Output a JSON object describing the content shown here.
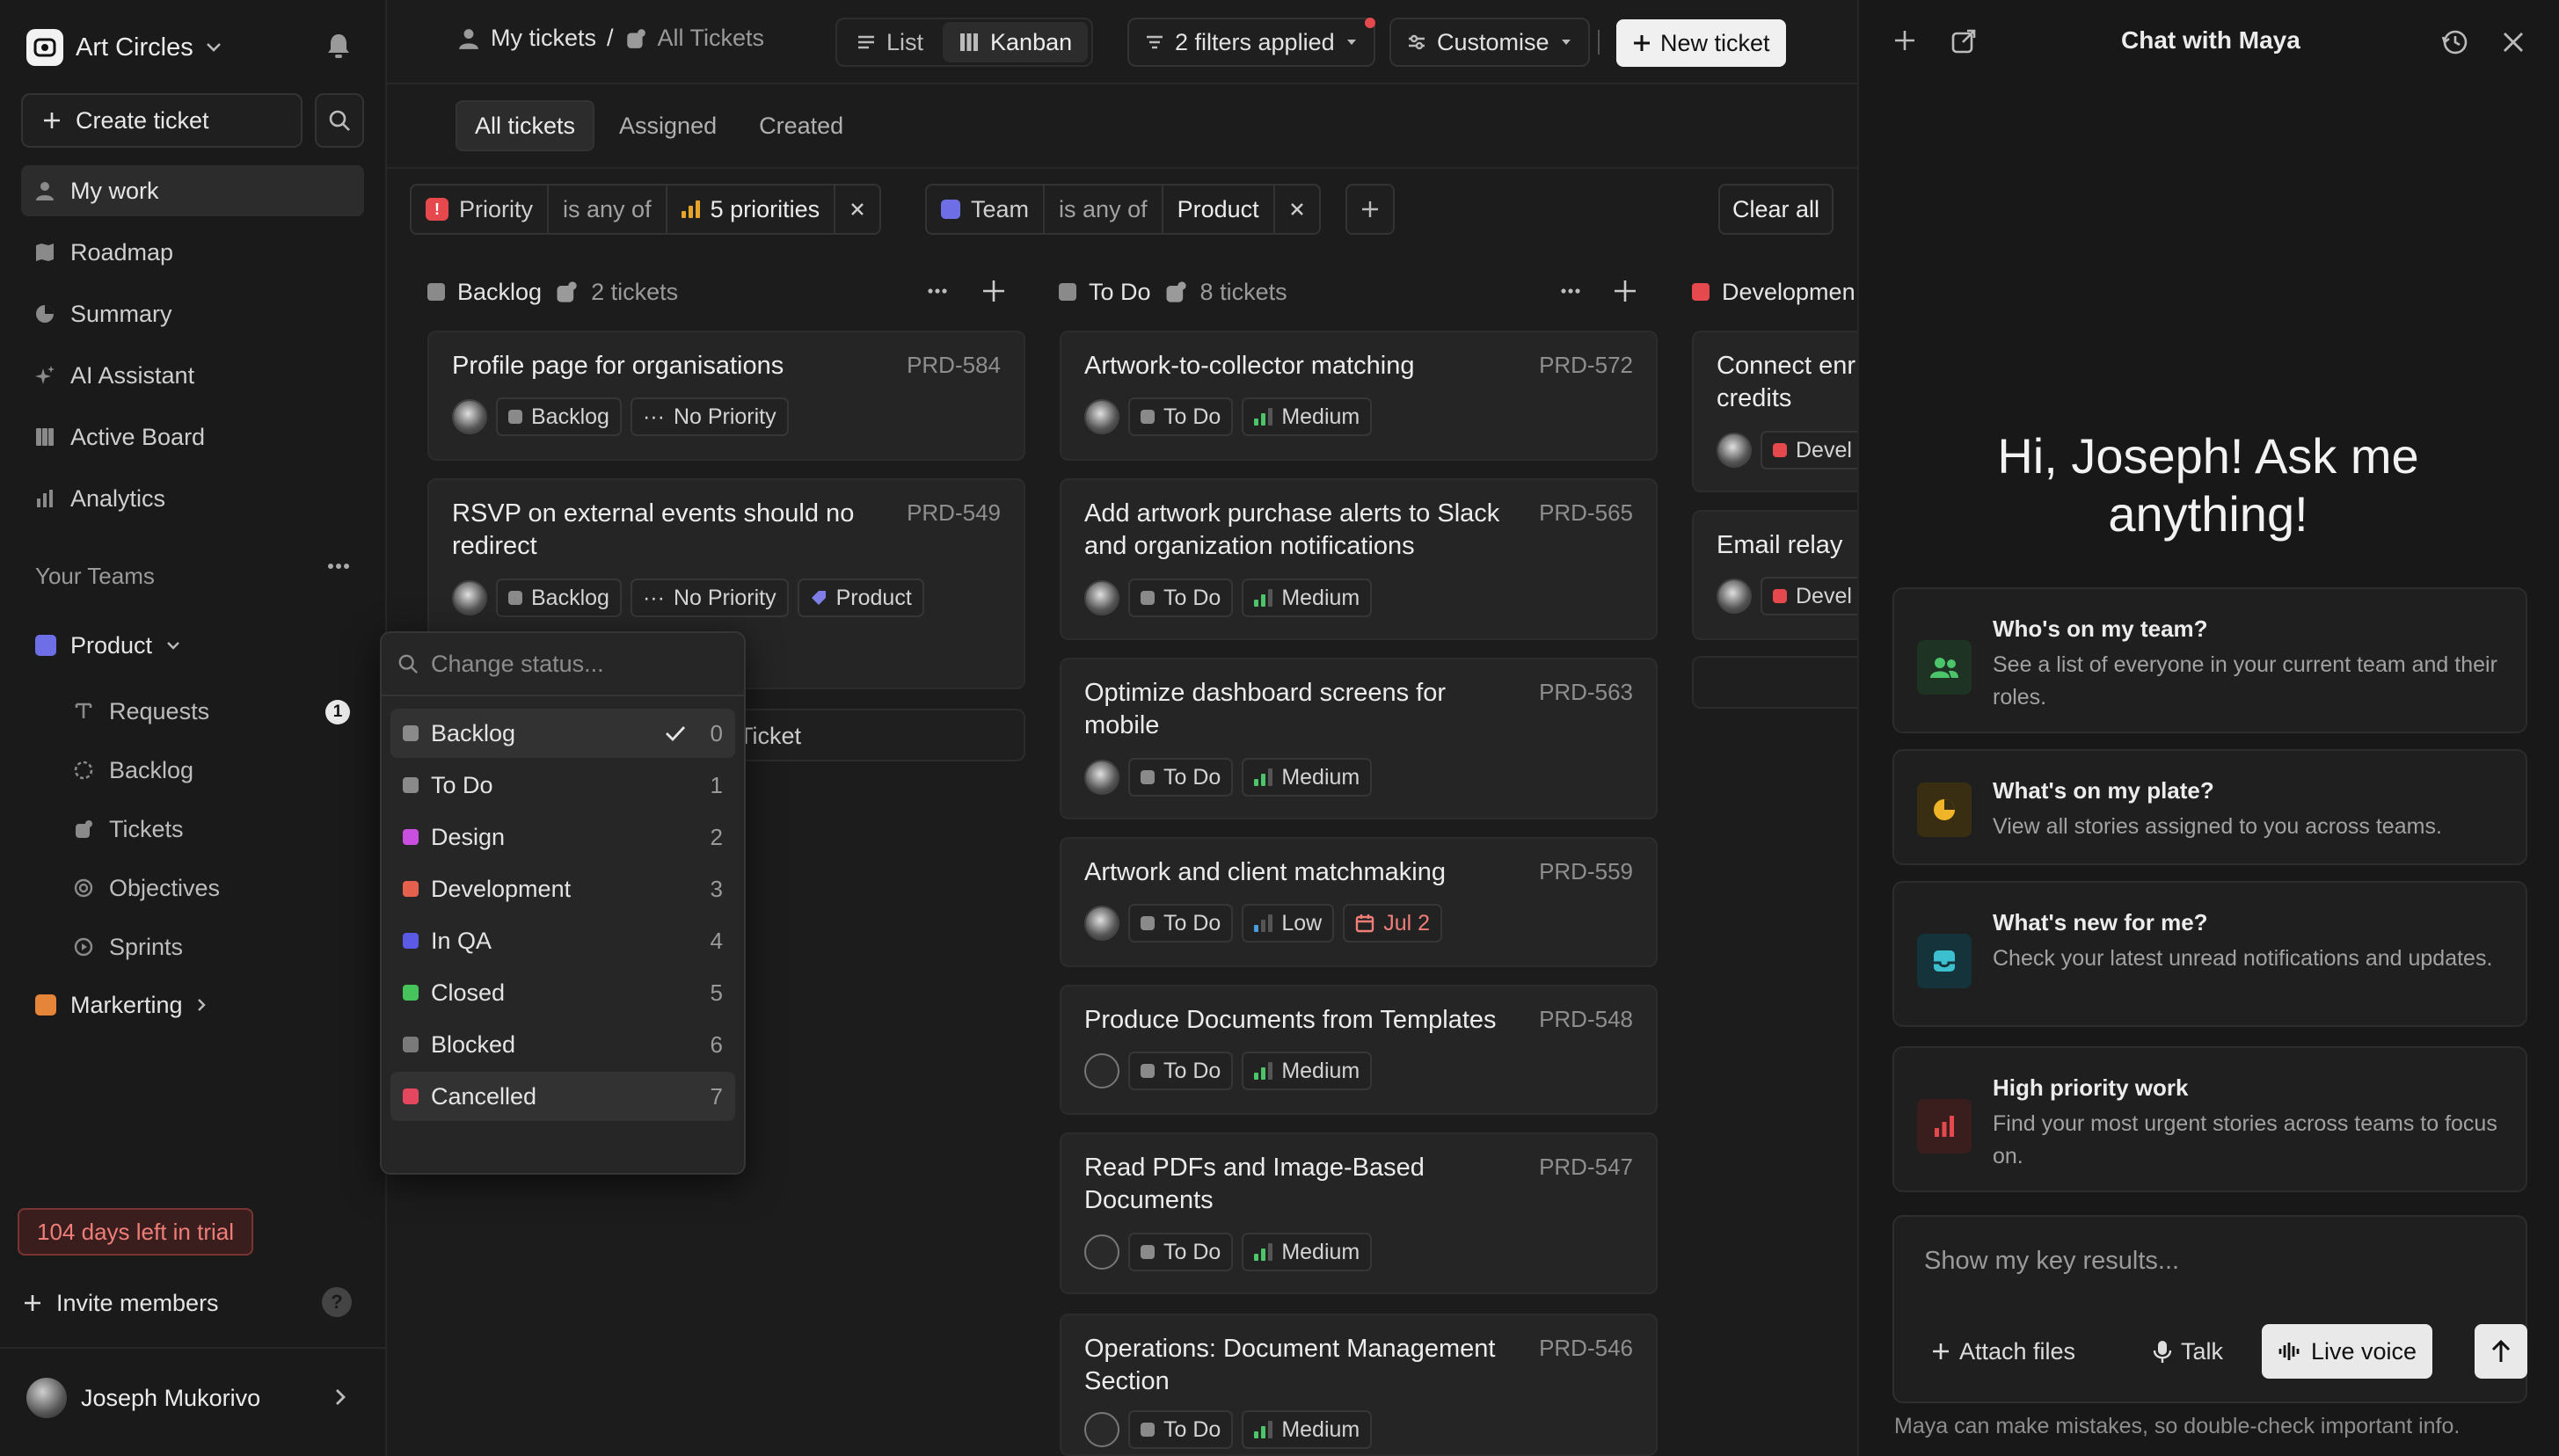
{
  "workspace": {
    "name": "Art Circles"
  },
  "sidebar": {
    "create_label": "Create ticket",
    "nav": [
      {
        "label": "My work",
        "icon": "person-icon"
      },
      {
        "label": "Roadmap",
        "icon": "roadmap-icon"
      },
      {
        "label": "Summary",
        "icon": "pie-icon"
      },
      {
        "label": "AI Assistant",
        "icon": "sparkle-icon"
      },
      {
        "label": "Active Board",
        "icon": "board-icon"
      },
      {
        "label": "Analytics",
        "icon": "bar-chart-icon"
      }
    ],
    "section_title": "Your Teams",
    "teams": [
      {
        "name": "Product",
        "color": "#6e6ee6"
      },
      {
        "name": "Markerting",
        "color": "#e5853a"
      }
    ],
    "product_items": [
      {
        "label": "Requests",
        "badge": "1"
      },
      {
        "label": "Backlog"
      },
      {
        "label": "Tickets"
      },
      {
        "label": "Objectives"
      },
      {
        "label": "Sprints"
      }
    ],
    "trial": "104 days left in trial",
    "invite": "Invite members",
    "help": "?",
    "user": "Joseph Mukorivo"
  },
  "header": {
    "crumb_root": "My tickets",
    "crumb_sep": "/",
    "crumb_current": "All Tickets",
    "views": [
      "List",
      "Kanban"
    ],
    "filters_label": "2 filters applied",
    "customise_label": "Customise",
    "new_ticket": "New ticket"
  },
  "tabs": [
    "All tickets",
    "Assigned",
    "Created"
  ],
  "filters": [
    {
      "field": "Priority",
      "op": "is any of",
      "value": "5 priorities"
    },
    {
      "field": "Team",
      "op": "is any of",
      "value": "Product"
    }
  ],
  "clear_all": "Clear all",
  "columns": [
    {
      "name": "Backlog",
      "count": "2 tickets",
      "color": "#8a8a8a"
    },
    {
      "name": "To Do",
      "count": "8 tickets",
      "color": "#8a8a8a"
    },
    {
      "name": "Developmen",
      "color": "#e5484d"
    }
  ],
  "backlog_cards": [
    {
      "title": [
        "Profile page for organisations"
      ],
      "id": "PRD-584",
      "status": "Backlog",
      "priority": "No Priority"
    },
    {
      "title": [
        "RSVP on external events should no",
        "redirect"
      ],
      "id": "PRD-549",
      "status": "Backlog",
      "priority": "No Priority",
      "tag": "Product"
    }
  ],
  "new_ticket_partial": "Ticket",
  "todo_cards": [
    {
      "title": [
        "Artwork-to-collector matching"
      ],
      "id": "PRD-572",
      "status": "To Do",
      "priority": "Medium"
    },
    {
      "title": [
        "Add artwork purchase alerts to Slack",
        "and organization notifications"
      ],
      "id": "PRD-565",
      "status": "To Do",
      "priority": "Medium"
    },
    {
      "title": [
        "Optimize dashboard screens for",
        "mobile"
      ],
      "id": "PRD-563",
      "status": "To Do",
      "priority": "Medium"
    },
    {
      "title": [
        "Artwork and client matchmaking"
      ],
      "id": "PRD-559",
      "status": "To Do",
      "priority": "Low",
      "due": "Jul 2"
    },
    {
      "title": [
        "Produce Documents from Templates"
      ],
      "id": "PRD-548",
      "status": "To Do",
      "priority": "Medium"
    },
    {
      "title": [
        "Read PDFs and Image-Based",
        "Documents"
      ],
      "id": "PRD-547",
      "status": "To Do",
      "priority": "Medium"
    },
    {
      "title": [
        "Operations: Document Management",
        "Section"
      ],
      "id": "PRD-546",
      "status": "To Do",
      "priority": "Medium"
    }
  ],
  "dev_cards": [
    {
      "title": [
        "Connect enr",
        "credits"
      ],
      "status": "Devel"
    },
    {
      "title": [
        "Email relay"
      ],
      "status": "Devel"
    }
  ],
  "status_dropdown": {
    "placeholder": "Change status...",
    "items": [
      {
        "label": "Backlog",
        "num": "0",
        "color": "#8a8a8a"
      },
      {
        "label": "To Do",
        "num": "1",
        "color": "#8a8a8a"
      },
      {
        "label": "Design",
        "num": "2",
        "color": "#c94fe0"
      },
      {
        "label": "Development",
        "num": "3",
        "color": "#e5604d"
      },
      {
        "label": "In QA",
        "num": "4",
        "color": "#5a5ae6"
      },
      {
        "label": "Closed",
        "num": "5",
        "color": "#46c35a"
      },
      {
        "label": "Blocked",
        "num": "6",
        "color": "#7a7a7a"
      },
      {
        "label": "Cancelled",
        "num": "7",
        "color": "#e5485e"
      }
    ]
  },
  "chat": {
    "title": "Chat with Maya",
    "hero": [
      "Hi, Joseph! Ask me",
      "anything!"
    ],
    "suggestions": [
      {
        "title": "Who's on my team?",
        "desc": "See a list of everyone in your current team and their roles."
      },
      {
        "title": "What's on my plate?",
        "desc": "View all stories assigned to you across teams."
      },
      {
        "title": "What's new for me?",
        "desc": "Check your latest unread notifications and updates."
      },
      {
        "title": "High priority work",
        "desc": "Find your most urgent stories across teams to focus on."
      }
    ],
    "placeholder": "Show my key results...",
    "attach": "Attach files",
    "talk": "Talk",
    "live": "Live voice",
    "disclaimer": "Maya can make mistakes, so double-check important info."
  }
}
